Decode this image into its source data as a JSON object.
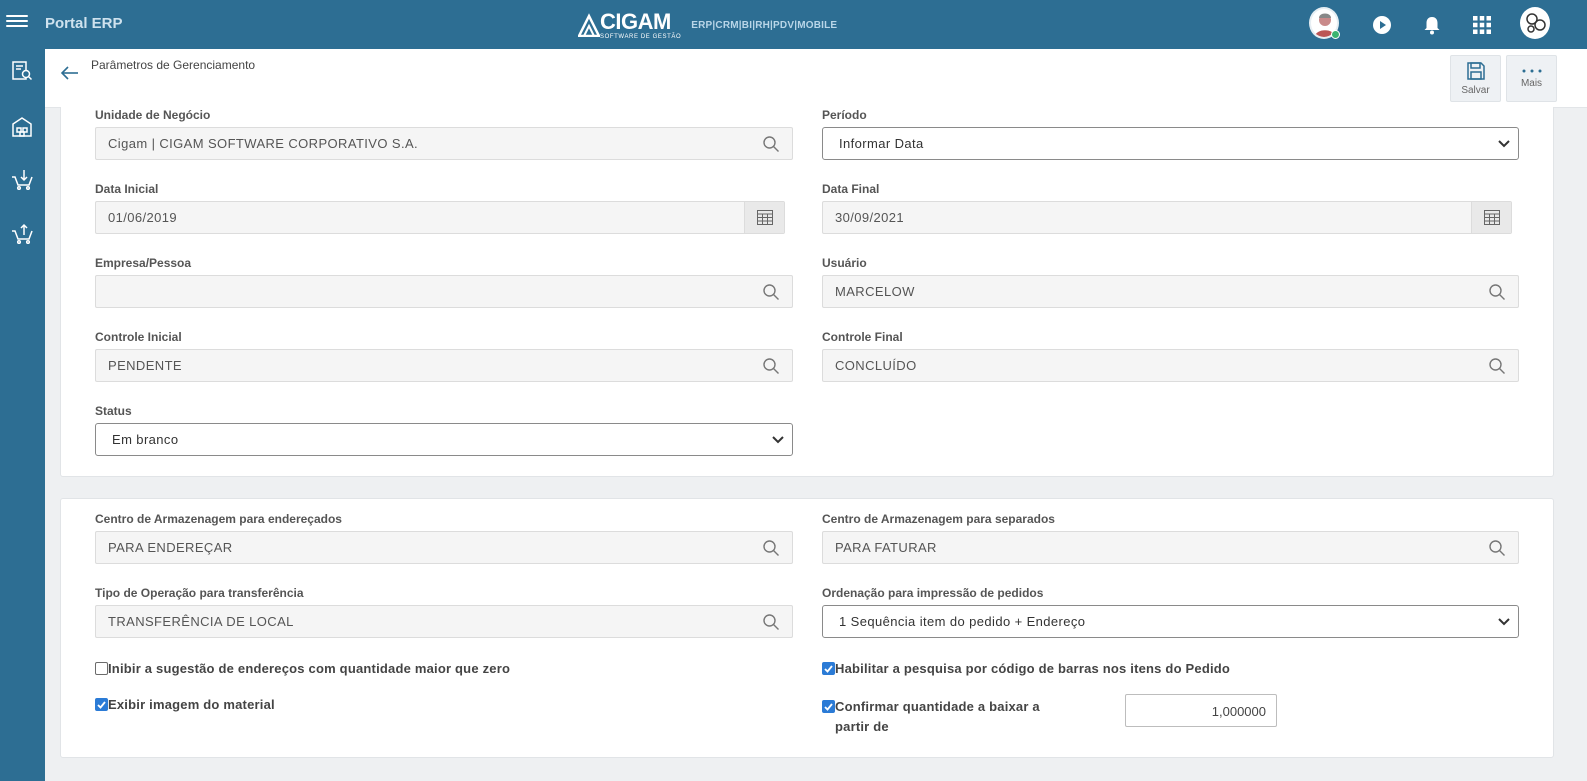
{
  "app": {
    "title": "Portal ERP",
    "brand_name": "CIGAM",
    "brand_tagline": "SOFTWARE DE GESTÃO",
    "modules": "ERP|CRM|BI|RH|PDV|MOBILE"
  },
  "topbar_icons": [
    "user-avatar-icon",
    "play-icon",
    "bell-icon",
    "apps-grid-icon",
    "company-avatar-icon"
  ],
  "sidebar": {
    "items": [
      {
        "icon": "document-search-icon"
      },
      {
        "icon": "warehouse-icon"
      },
      {
        "icon": "cart-download-icon"
      },
      {
        "icon": "cart-upload-icon"
      }
    ]
  },
  "header": {
    "title": "Parâmetros de Gerenciamento",
    "save_label": "Salvar",
    "more_label": "Mais"
  },
  "filters": {
    "business_unit": {
      "label": "Unidade de Negócio",
      "value": "Cigam | CIGAM SOFTWARE CORPORATIVO S.A."
    },
    "period": {
      "label": "Período",
      "value": "Informar Data"
    },
    "start_date": {
      "label": "Data Inicial",
      "value": "01/06/2019"
    },
    "end_date": {
      "label": "Data Final",
      "value": "30/09/2021"
    },
    "company": {
      "label": "Empresa/Pessoa",
      "value": ""
    },
    "user": {
      "label": "Usuário",
      "value": "MARCELOW"
    },
    "control_start": {
      "label": "Controle Inicial",
      "value": "PENDENTE"
    },
    "control_end": {
      "label": "Controle Final",
      "value": "CONCLUÍDO"
    },
    "status": {
      "label": "Status",
      "value": "Em branco"
    }
  },
  "settings": {
    "storage_addressed": {
      "label": "Centro de Armazenagem para endereçados",
      "value": "PARA ENDEREÇAR"
    },
    "storage_separated": {
      "label": "Centro de Armazenagem para separados",
      "value": "PARA FATURAR"
    },
    "transfer_operation": {
      "label": "Tipo de Operação para transferência",
      "value": "TRANSFERÊNCIA DE LOCAL"
    },
    "print_order": {
      "label": "Ordenação para impressão de pedidos",
      "value": "1 Sequência item do pedido + Endereço"
    },
    "inhibit_suggestion": {
      "label": "Inibir a sugestão de endereços com quantidade maior que zero",
      "checked": false
    },
    "barcode_search": {
      "label": "Habilitar a pesquisa por código de barras nos itens do Pedido",
      "checked": true
    },
    "show_image": {
      "label": "Exibir imagem do material",
      "checked": true
    },
    "confirm_quantity": {
      "label": "Confirmar quantidade a baixar a partir de",
      "checked": true,
      "value": "1,000000"
    }
  },
  "colors": {
    "primary": "#2d6e93",
    "checkbox": "#2b7bd6",
    "background": "#eef0f2"
  }
}
